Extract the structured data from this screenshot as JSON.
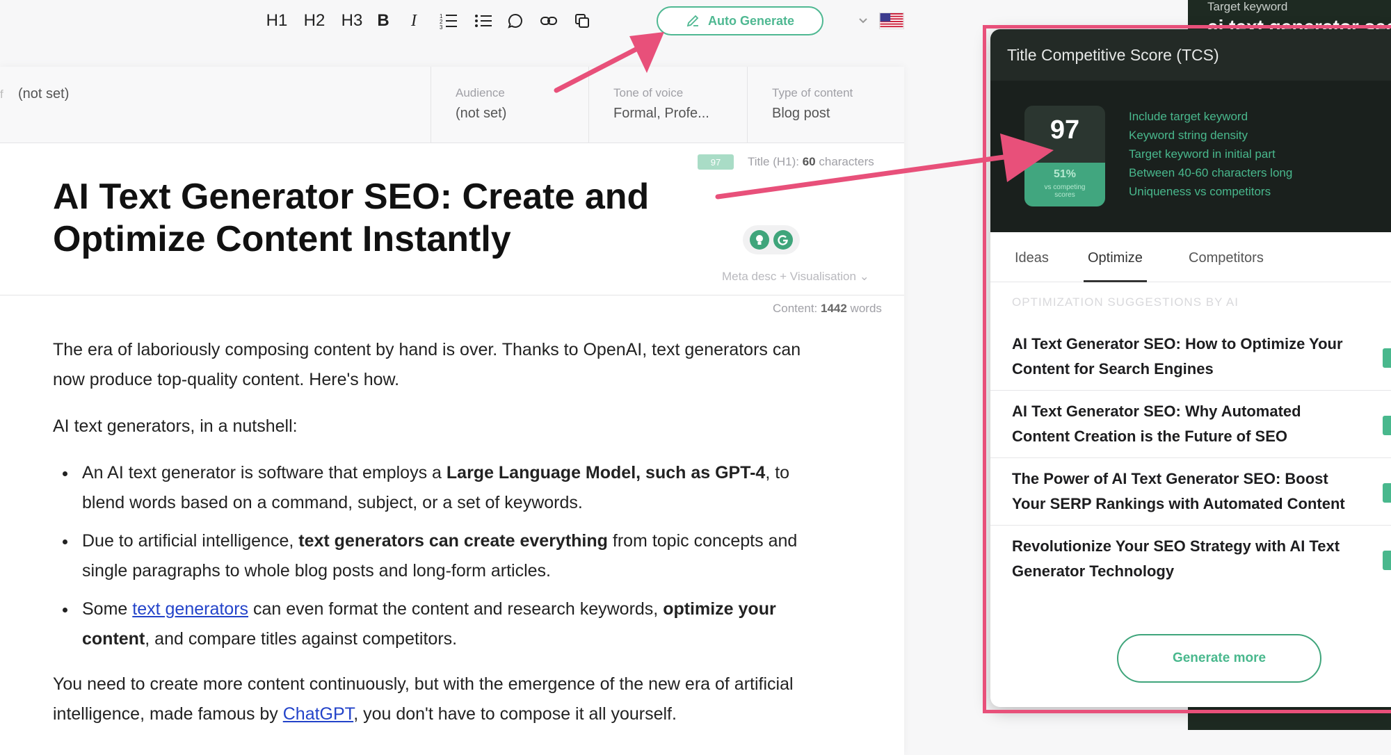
{
  "toolbar": {
    "h1": "H1",
    "h2": "H2",
    "h3": "H3",
    "bold": "B",
    "italic": "I",
    "auto_generate": "Auto Generate",
    "icons": [
      "ordered-list-icon",
      "bullet-list-icon",
      "comment-icon",
      "link-icon",
      "copy-icon",
      "pencil-icon",
      "chevron-down-icon",
      "us-flag-icon"
    ]
  },
  "meta": {
    "left_prefix": "f",
    "left_value": "(not set)",
    "audience_label": "Audience",
    "audience_value": "(not set)",
    "tone_label": "Tone of voice",
    "tone_value": "Formal, Profe...",
    "type_label": "Type of content",
    "type_value": "Blog post"
  },
  "title_badge": "97",
  "title_info": {
    "label": "Title (H1): ",
    "count": "60",
    "unit": " characters"
  },
  "doc_title": "AI Text Generator SEO: Create and Optimize Content Instantly",
  "meta_desc": "Meta desc + Visualisation",
  "content_count": {
    "label": "Content: ",
    "count": "1442",
    "unit": " words"
  },
  "body": {
    "p1": "The era of laboriously composing content by hand is over. Thanks to OpenAI, text generators can now produce top-quality content. Here's how.",
    "p2": "AI text generators, in a nutshell:",
    "b1_a": "An AI text generator is software that employs a ",
    "b1_bold": "Large Language Model, such as GPT-4",
    "b1_b": ", to blend words based on a command, subject, or a set of keywords.",
    "b2_a": "Due to artificial intelligence, ",
    "b2_bold": "text generators can create everything",
    "b2_b": " from topic concepts and single paragraphs to whole blog posts and long-form articles.",
    "b3_a": "Some ",
    "b3_link": "text generators",
    "b3_b": " can even format the content and research keywords, ",
    "b3_bold": "optimize your content",
    "b3_c": ", and compare titles against competitors.",
    "p3_a": "You need to create more content continuously, but with the emergence of the new era of artificial intelligence, made famous by ",
    "p3_link": "ChatGPT",
    "p3_b": ", you don't have to compose it all yourself."
  },
  "target_keyword": {
    "label": "Target keyword",
    "value": "ai text generator seo"
  },
  "panel": {
    "title": "Title Competitive Score (TCS)",
    "score": "97",
    "pct": "51%",
    "pct_sub": "vs competing scores",
    "criteria": [
      "Include target keyword",
      "Keyword string density",
      "Target keyword in initial part",
      "Between 40-60 characters long",
      "Uniqueness vs competitors"
    ],
    "tabs": [
      "Ideas",
      "Optimize",
      "Competitors"
    ],
    "active_tab": "Optimize",
    "heading": "OPTIMIZATION SUGGESTIONS BY AI",
    "suggestions": [
      "AI Text Generator SEO: How to Optimize Your Content for Search Engines",
      "AI Text Generator SEO: Why Automated Content Creation is the Future of SEO",
      "The Power of AI Text Generator SEO: Boost Your SERP Rankings with Automated Content",
      "Revolutionize Your SEO Strategy with AI Text Generator Technology"
    ],
    "generate_more": "Generate more"
  },
  "colors": {
    "accent": "#49b88d",
    "highlight": "#e8507a",
    "dark": "#1a201d",
    "link": "#2343c9"
  }
}
